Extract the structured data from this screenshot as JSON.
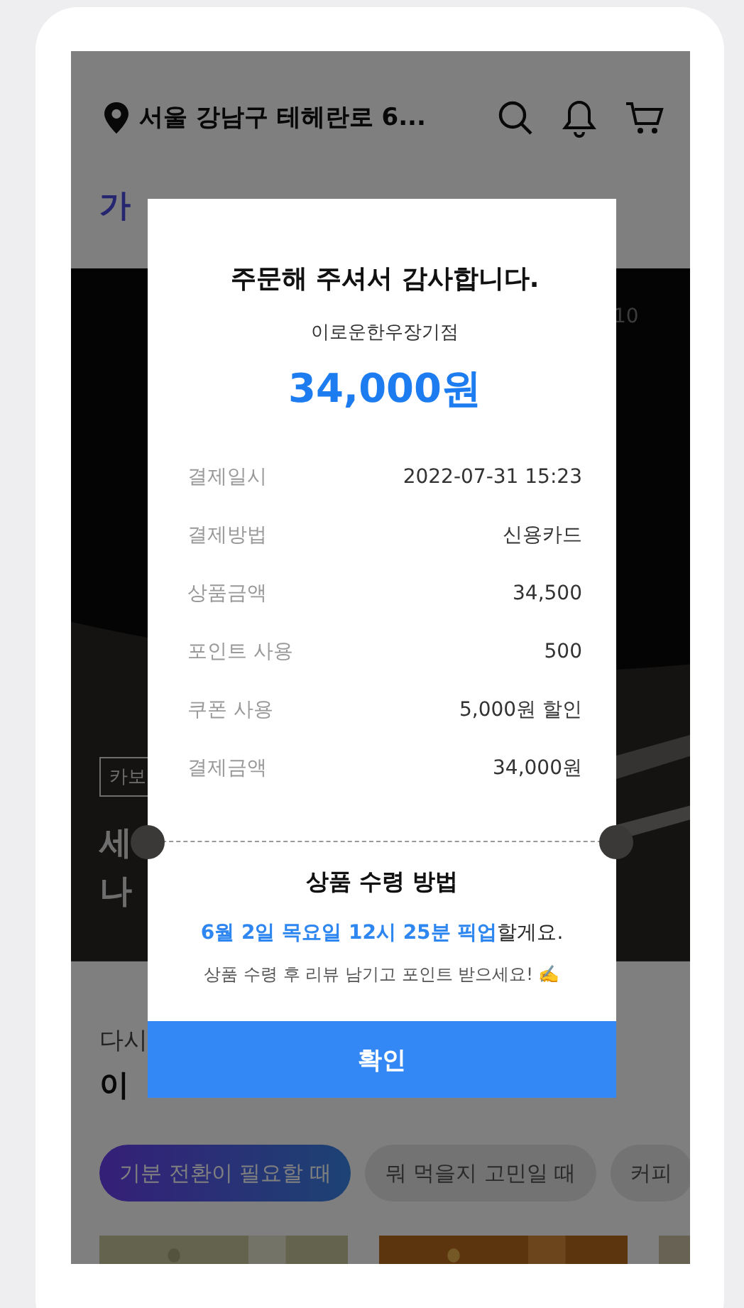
{
  "header": {
    "location": "서울 강남구 테헤란로 6..."
  },
  "heading": "가",
  "hero": {
    "kind": "picture",
    "counter": "10",
    "tag": "카보",
    "title_lines": [
      "세",
      "나"
    ]
  },
  "section": {
    "subtitle": "다시",
    "title": "이 "
  },
  "chips": [
    {
      "label": "기분 전환이 필요할 때",
      "selected": true
    },
    {
      "label": "뭐 먹을지 고민일 때",
      "selected": false
    },
    {
      "label": "커피",
      "selected": false
    }
  ],
  "dialog": {
    "title": "주문해 주셔서 감사합니다.",
    "store": "이로운한우장기점",
    "total": "34,000원",
    "rows": [
      {
        "label": "결제일시",
        "value": "2022-07-31 15:23"
      },
      {
        "label": "결제방법",
        "value": "신용카드"
      },
      {
        "label": "상품금액",
        "value": "34,500"
      },
      {
        "label": "포인트 사용",
        "value": "500"
      },
      {
        "label": "쿠폰 사용",
        "value": "5,000원 할인"
      },
      {
        "label": "결제금액",
        "value": "34,000원"
      }
    ],
    "pickup_title": "상품 수령 방법",
    "pickup_text": "**6월 2일 목요일 12시 25분 픽업**할게요.",
    "review_note": "상품 수령 후 리뷰 남기고 포인트 받으세요! ✍️",
    "confirm": "확인"
  }
}
